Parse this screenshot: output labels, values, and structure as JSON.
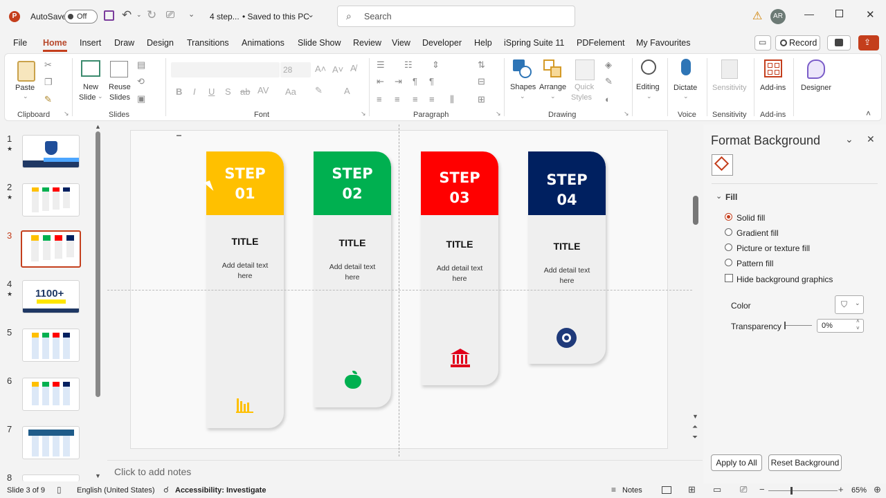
{
  "titlebar": {
    "autosave_label": "AutoSave",
    "autosave_state": "Off",
    "doc_title": "4 step...",
    "save_status": "• Saved to this PC",
    "search_placeholder": "Search",
    "user_initials": "AR"
  },
  "menu": {
    "tabs": [
      "File",
      "Home",
      "Insert",
      "Draw",
      "Design",
      "Transitions",
      "Animations",
      "Slide Show",
      "Review",
      "View",
      "Developer",
      "Help",
      "iSpring Suite 11",
      "PDFelement",
      "My Favourites"
    ],
    "record_label": "Record"
  },
  "ribbon": {
    "paste": "Paste",
    "new_slide": [
      "New",
      "Slide"
    ],
    "reuse_slides": [
      "Reuse",
      "Slides"
    ],
    "font_size": "28",
    "shapes": "Shapes",
    "arrange": "Arrange",
    "quick_styles": [
      "Quick",
      "Styles"
    ],
    "editing": "Editing",
    "dictate": "Dictate",
    "sensitivity": "Sensitivity",
    "addins": "Add-ins",
    "designer": "Designer",
    "groups": {
      "clipboard": "Clipboard",
      "slides": "Slides",
      "font": "Font",
      "paragraph": "Paragraph",
      "drawing": "Drawing",
      "voice": "Voice",
      "sensitivity": "Sensitivity",
      "addins": "Add-ins"
    }
  },
  "thumbnails": [
    "1",
    "2",
    "3",
    "4",
    "5",
    "6",
    "7",
    "8"
  ],
  "thumb4_text": "1100+",
  "slide": {
    "steps": [
      {
        "line1": "STEP",
        "line2": "01",
        "title": "TITLE",
        "detail1": "Add detail text",
        "detail2": "here",
        "color": "#FFC000",
        "icon": "bar-chart-icon"
      },
      {
        "line1": "STEP",
        "line2": "02",
        "title": "TITLE",
        "detail1": "Add detail text",
        "detail2": "here",
        "color": "#00B050",
        "icon": "apple-icon"
      },
      {
        "line1": "STEP",
        "line2": "03",
        "title": "TITLE",
        "detail1": "Add detail text",
        "detail2": "here",
        "color": "#FF0000",
        "icon": "bank-icon"
      },
      {
        "line1": "STEP",
        "line2": "04",
        "title": "TITLE",
        "detail1": "Add detail text",
        "detail2": "here",
        "color": "#002060",
        "icon": "aperture-icon"
      }
    ]
  },
  "notes_placeholder": "Click to add notes",
  "format_pane": {
    "title": "Format Background",
    "section": "Fill",
    "options": [
      "Solid fill",
      "Gradient fill",
      "Picture or texture fill",
      "Pattern fill"
    ],
    "selected_option": "Solid fill",
    "hide_graphics": "Hide background graphics",
    "color_label": "Color",
    "transparency_label": "Transparency",
    "transparency_value": "0%",
    "apply_all": "Apply to All",
    "reset": "Reset Background"
  },
  "status": {
    "slide_info": "Slide 3 of 9",
    "language": "English (United States)",
    "accessibility": "Accessibility: Investigate",
    "notes": "Notes",
    "zoom": "65%"
  }
}
